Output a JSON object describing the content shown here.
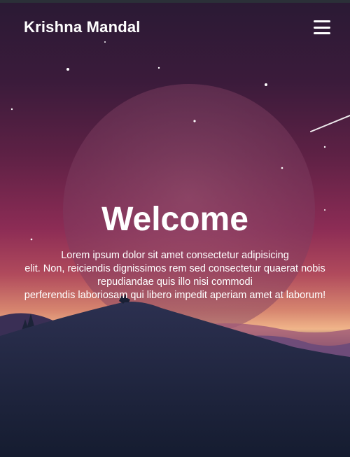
{
  "nav": {
    "brand": "Krishna Mandal",
    "menu_icon": "hamburger-menu-icon"
  },
  "hero": {
    "title": "Welcome",
    "text_lines": [
      "Lorem ipsum dolor sit amet consectetur adipisicing",
      "elit. Non, reiciendis dignissimos rem sed consectetur quaerat nobis",
      "repudiandae quis illo nisi commodi",
      "perferendis laboriosam qui libero impedit aperiam amet at laborum!"
    ]
  },
  "colors": {
    "sky_top": "#2a1a34",
    "sky_mid": "#8c2c55",
    "horizon": "#f0b58a",
    "ground": "#141b2f",
    "text": "#ffffff"
  }
}
